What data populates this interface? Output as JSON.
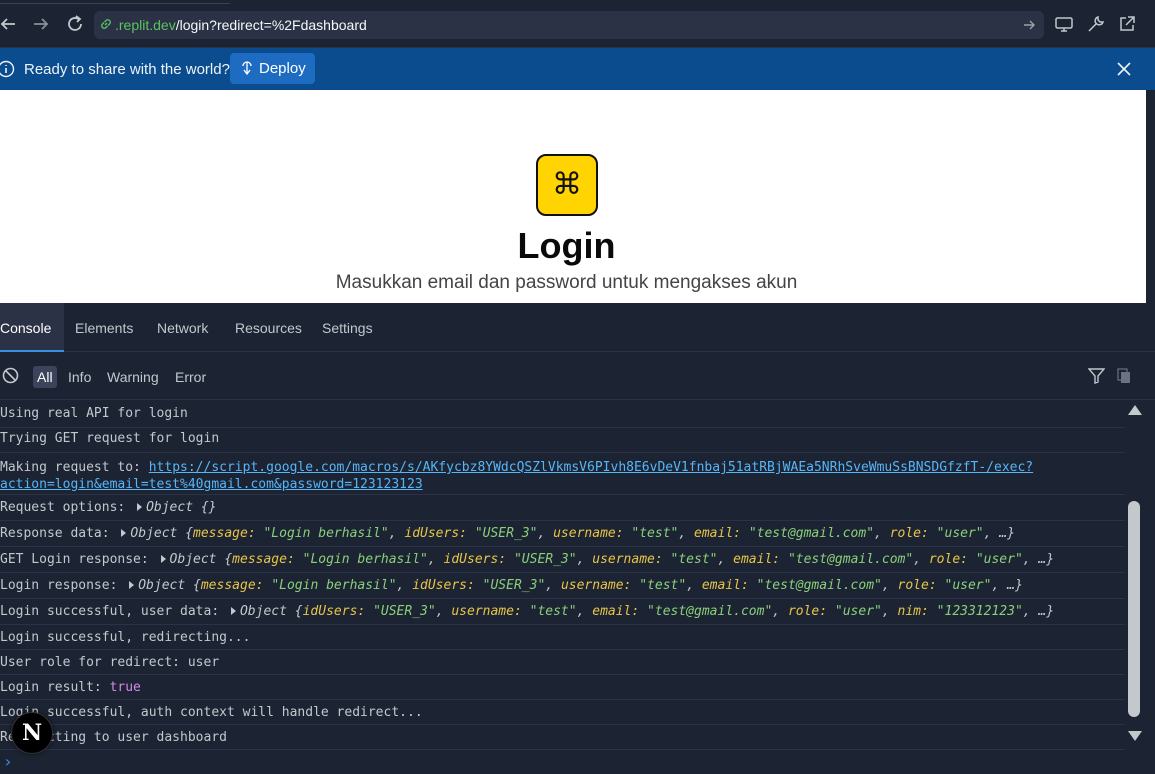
{
  "browser": {
    "url_domain": ".replit.dev",
    "url_path": "/login?redirect=%2Fdashboard",
    "icons": [
      "back-icon",
      "forward-icon",
      "reload-icon",
      "link-icon",
      "go-icon",
      "devices-icon",
      "wrench-icon",
      "open-external-icon"
    ]
  },
  "banner": {
    "message": "Ready to share with the world?",
    "deploy_label": "Deploy",
    "bg_color": "#0a4c8e"
  },
  "page": {
    "logo_glyph": "⌘",
    "title": "Login",
    "subtitle": "Masukkan email dan password untuk mengakses akun",
    "accent_color": "#ffd400"
  },
  "devtools": {
    "tabs": [
      "Console",
      "Elements",
      "Network",
      "Resources",
      "Settings"
    ],
    "active_tab": "Console",
    "levels": [
      "All",
      "Info",
      "Warning",
      "Error"
    ],
    "active_level": "All",
    "logs": {
      "l1": "Using real API for login",
      "l2": "Trying GET request for login",
      "l3_prefix": "Making request to: ",
      "l3_link1": "https://script.google.com/macros/s/AKfycbz8YWdcQSZlVkmsV6PIvh8E6vDeV1fnbaj51atRBjWAEa5NRhSveWmuSsBNSDGfzfT-/exec?",
      "l3_link2": "action=login&email=test%40gmail.com&password=123123123",
      "l4_prefix": "Request options: ",
      "l4_obj": "Object {}",
      "l5_prefix": "Response data: ",
      "l6_prefix": "GET Login response: ",
      "l7_prefix": "Login response: ",
      "obj_resp": {
        "open": "Object {",
        "k1": "message: ",
        "v1": "\"Login berhasil\"",
        "k2": "idUsers: ",
        "v2": "\"USER_3\"",
        "k3": "username: ",
        "v3": "\"test\"",
        "k4": "email: ",
        "v4": "\"test@gmail.com\"",
        "k5": "role: ",
        "v5": "\"user\"",
        "tail": ", …}"
      },
      "l8_prefix": "Login successful, user data: ",
      "obj_user": {
        "open": "Object {",
        "k1": "idUsers: ",
        "v1": "\"USER_3\"",
        "k2": "username: ",
        "v2": "\"test\"",
        "k3": "email: ",
        "v3": "\"test@gmail.com\"",
        "k4": "role: ",
        "v4": "\"user\"",
        "k5": "nim: ",
        "v5": "\"123312123\"",
        "tail": ", …}"
      },
      "l9": "Login successful, redirecting...",
      "l10": "User role for redirect: user",
      "l11_prefix": "Login result: ",
      "l11_value": "true",
      "l12": "Login successful, auth context will handle redirect...",
      "l13": "Redirecting to user dashboard"
    },
    "prompt_glyph": "›"
  },
  "overlay": {
    "next_badge": "N"
  }
}
